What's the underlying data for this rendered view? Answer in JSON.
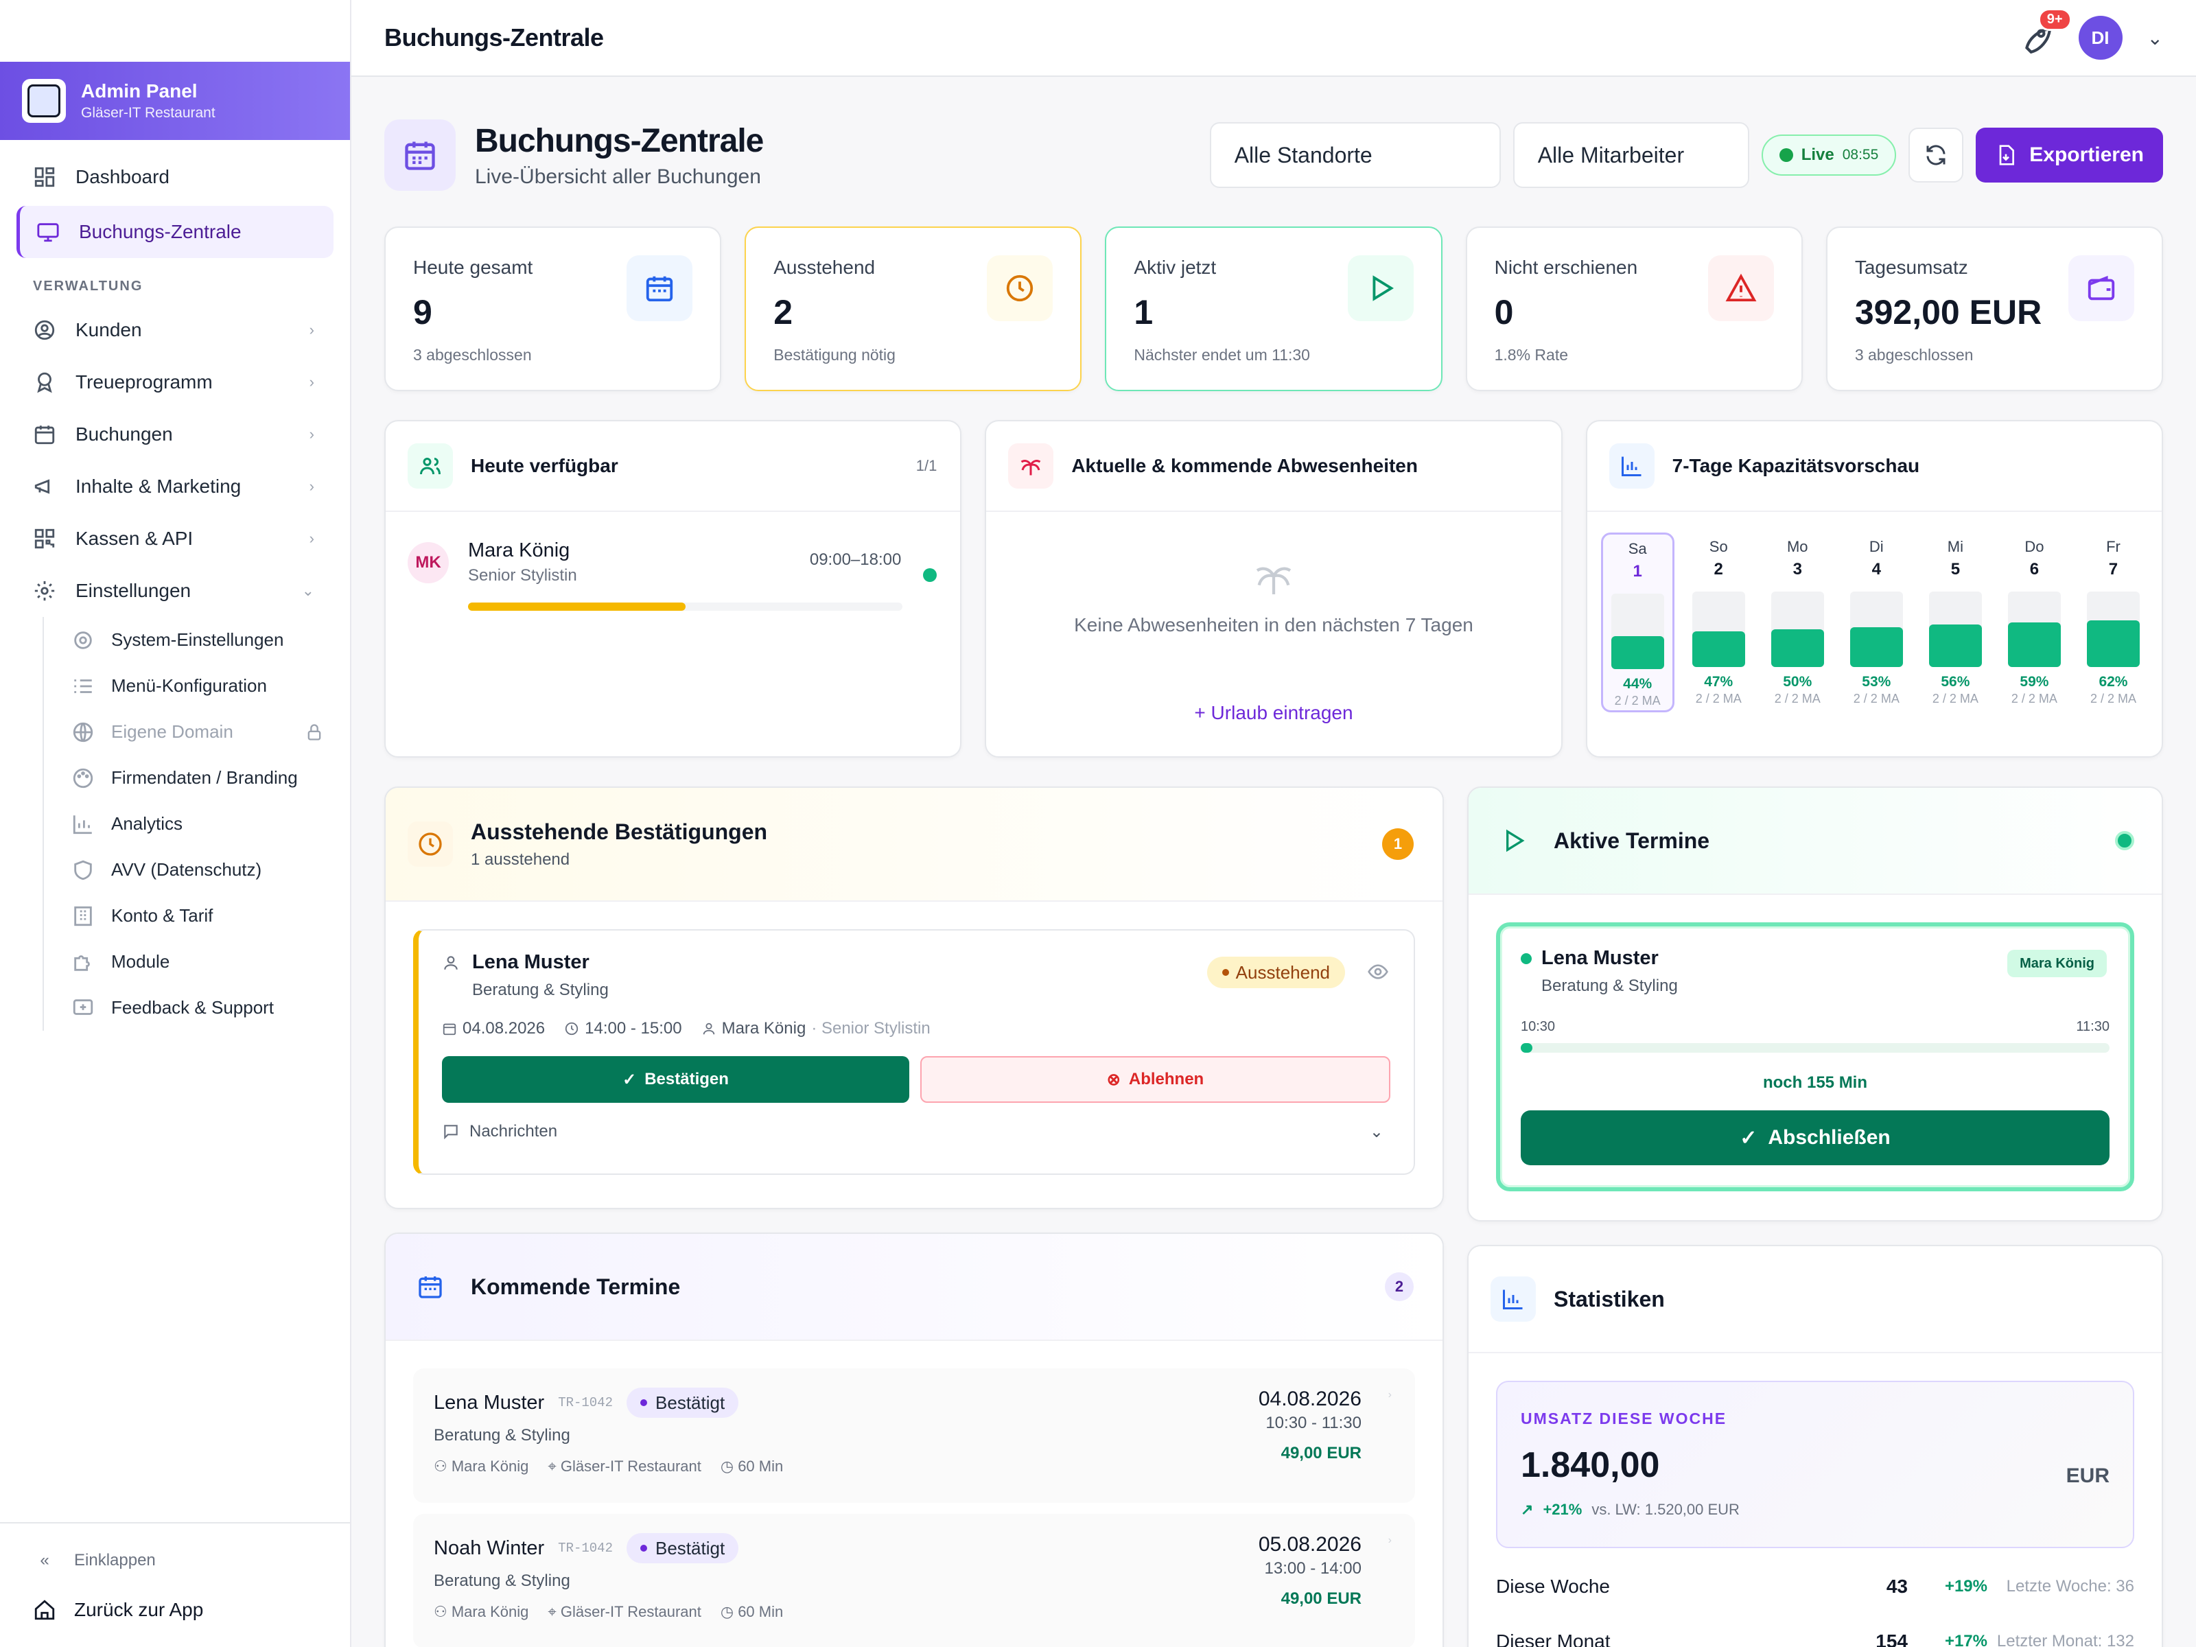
{
  "topbar": {
    "title": "Buchungs-Zentrale",
    "notif_count": "9+",
    "avatar": "DI"
  },
  "sidebar": {
    "brand_title": "Admin Panel",
    "brand_sub": "Gläser-IT Restaurant",
    "dashboard": "Dashboard",
    "zentrale": "Buchungs-Zentrale",
    "section": "VERWALTUNG",
    "items": [
      "Kunden",
      "Treueprogramm",
      "Buchungen",
      "Inhalte & Marketing",
      "Kassen & API",
      "Einstellungen"
    ],
    "sub": [
      "System-Einstellungen",
      "Menü-Konfiguration",
      "Eigene Domain",
      "Firmendaten / Branding",
      "Analytics",
      "AVV (Datenschutz)",
      "Konto & Tarif",
      "Module",
      "Feedback & Support"
    ],
    "collapse": "Einklappen",
    "back": "Zurück zur App"
  },
  "header": {
    "title": "Buchungs-Zentrale",
    "subtitle": "Live-Übersicht aller Buchungen",
    "location": "Alle Standorte",
    "staff": "Alle Mitarbeiter",
    "live": "Live",
    "live_time": "08:55",
    "export": "Exportieren"
  },
  "kpis": [
    {
      "label": "Heute gesamt",
      "value": "9",
      "sub": "3 abgeschlossen"
    },
    {
      "label": "Ausstehend",
      "value": "2",
      "sub": "Bestätigung nötig"
    },
    {
      "label": "Aktiv jetzt",
      "value": "1",
      "sub": "Nächster endet um 11:30"
    },
    {
      "label": "Nicht erschienen",
      "value": "0",
      "sub": "1.8% Rate"
    },
    {
      "label": "Tagesumsatz",
      "value": "392,00 EUR",
      "sub": "3 abgeschlossen"
    }
  ],
  "available": {
    "title": "Heute verfügbar",
    "count": "1/1",
    "initials": "MK",
    "name": "Mara König",
    "role": "Senior Stylistin",
    "time": "09:00–18:00",
    "progress": 0.5
  },
  "absences": {
    "title": "Aktuelle & kommende Abwesenheiten",
    "empty": "Keine Abwesenheiten in den nächsten 7 Tagen",
    "add": "Urlaub eintragen"
  },
  "capacity": {
    "title": "7-Tage Kapazitätsvorschau",
    "days": [
      {
        "d": "Sa",
        "n": "1",
        "p": "44%",
        "m": "2 / 2 MA",
        "v": 44
      },
      {
        "d": "So",
        "n": "2",
        "p": "47%",
        "m": "2 / 2 MA",
        "v": 47
      },
      {
        "d": "Mo",
        "n": "3",
        "p": "50%",
        "m": "2 / 2 MA",
        "v": 50
      },
      {
        "d": "Di",
        "n": "4",
        "p": "53%",
        "m": "2 / 2 MA",
        "v": 53
      },
      {
        "d": "Mi",
        "n": "5",
        "p": "56%",
        "m": "2 / 2 MA",
        "v": 56
      },
      {
        "d": "Do",
        "n": "6",
        "p": "59%",
        "m": "2 / 2 MA",
        "v": 59
      },
      {
        "d": "Fr",
        "n": "7",
        "p": "62%",
        "m": "2 / 2 MA",
        "v": 62
      }
    ]
  },
  "pending": {
    "title": "Ausstehende Bestätigungen",
    "sub": "1 ausstehend",
    "count": "1",
    "name": "Lena Muster",
    "service": "Beratung & Styling",
    "status": "Ausstehend",
    "date": "04.08.2026",
    "time": "14:00 - 15:00",
    "staff": "Mara König",
    "staff_role": "· Senior Stylistin",
    "confirm": "Bestätigen",
    "reject": "Ablehnen",
    "messages": "Nachrichten"
  },
  "upcoming": {
    "title": "Kommende Termine",
    "count": "2",
    "items": [
      {
        "name": "Lena Muster",
        "id": "TR-1042",
        "status": "Bestätigt",
        "service": "Beratung & Styling",
        "staff": "Mara König",
        "loc": "Gläser-IT Restaurant",
        "dur": "60 Min",
        "date": "04.08.2026",
        "time": "10:30 - 11:30",
        "price": "49,00 EUR"
      },
      {
        "name": "Noah Winter",
        "id": "TR-1042",
        "status": "Bestätigt",
        "service": "Beratung & Styling",
        "staff": "Mara König",
        "loc": "Gläser-IT Restaurant",
        "dur": "60 Min",
        "date": "05.08.2026",
        "time": "13:00 - 14:00",
        "price": "49,00 EUR"
      }
    ]
  },
  "active": {
    "title": "Aktive Termine",
    "name": "Lena Muster",
    "service": "Beratung & Styling",
    "staff": "Mara König",
    "start": "10:30",
    "end": "11:30",
    "remaining": "noch 155 Min",
    "button": "Abschließen",
    "progress": 0.02
  },
  "stats": {
    "title": "Statistiken",
    "rev_label": "UMSATZ DIESE WOCHE",
    "rev_value": "1.840,00",
    "rev_cur": "EUR",
    "rev_growth": "+21%",
    "rev_prev": "vs. LW: 1.520,00 EUR",
    "rows": [
      {
        "label": "Diese Woche",
        "n": "43",
        "g": "+19%",
        "p": "Letzte Woche: 36"
      },
      {
        "label": "Dieser Monat",
        "n": "154",
        "g": "+17%",
        "p": "Letzter Monat: 132"
      }
    ]
  },
  "colors": {
    "accent": "#6d28d9",
    "green": "#047857",
    "amber": "#f5b800"
  }
}
